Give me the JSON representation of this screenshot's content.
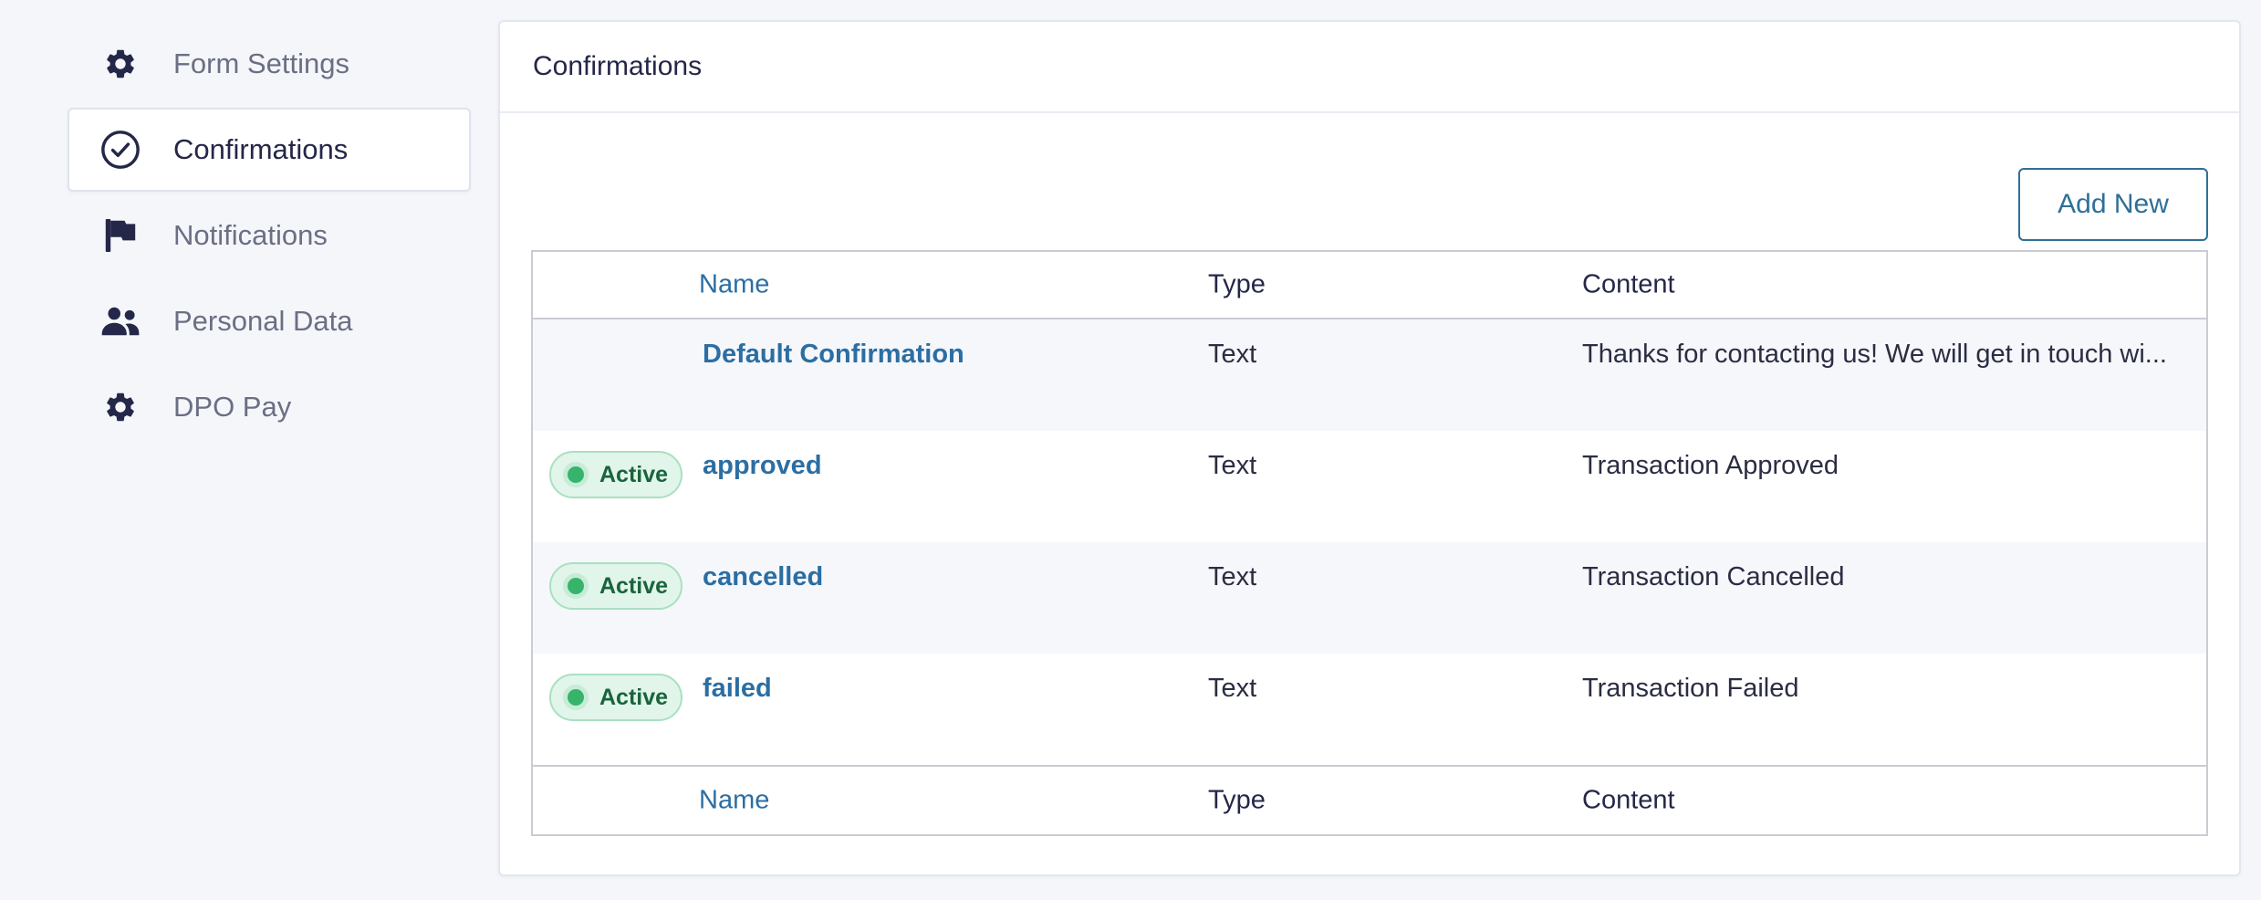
{
  "sidebar": {
    "items": [
      {
        "label": "Form Settings",
        "icon": "gear-icon"
      },
      {
        "label": "Confirmations",
        "icon": "check-circle-icon",
        "active": true
      },
      {
        "label": "Notifications",
        "icon": "flag-icon"
      },
      {
        "label": "Personal Data",
        "icon": "users-icon"
      },
      {
        "label": "DPO Pay",
        "icon": "gear-icon"
      }
    ]
  },
  "panel": {
    "title": "Confirmations",
    "add_new_label": "Add New"
  },
  "table": {
    "columns": {
      "name": "Name",
      "type": "Type",
      "content": "Content"
    },
    "rows": [
      {
        "name": "Default Confirmation",
        "type": "Text",
        "content": "Thanks for contacting us! We will get in touch wi...",
        "badge": null
      },
      {
        "name": "approved",
        "type": "Text",
        "content": "Transaction Approved",
        "badge": "Active"
      },
      {
        "name": "cancelled",
        "type": "Text",
        "content": "Transaction Cancelled",
        "badge": "Active"
      },
      {
        "name": "failed",
        "type": "Text",
        "content": "Transaction Failed",
        "badge": "Active"
      }
    ]
  },
  "colors": {
    "accent": "#2b6ea3",
    "button_border": "#2f6f98",
    "active_badge_bg": "#e1f5ea",
    "active_badge_text": "#19643c",
    "active_dot": "#37b46c",
    "page_bg": "#f4f6fa"
  }
}
